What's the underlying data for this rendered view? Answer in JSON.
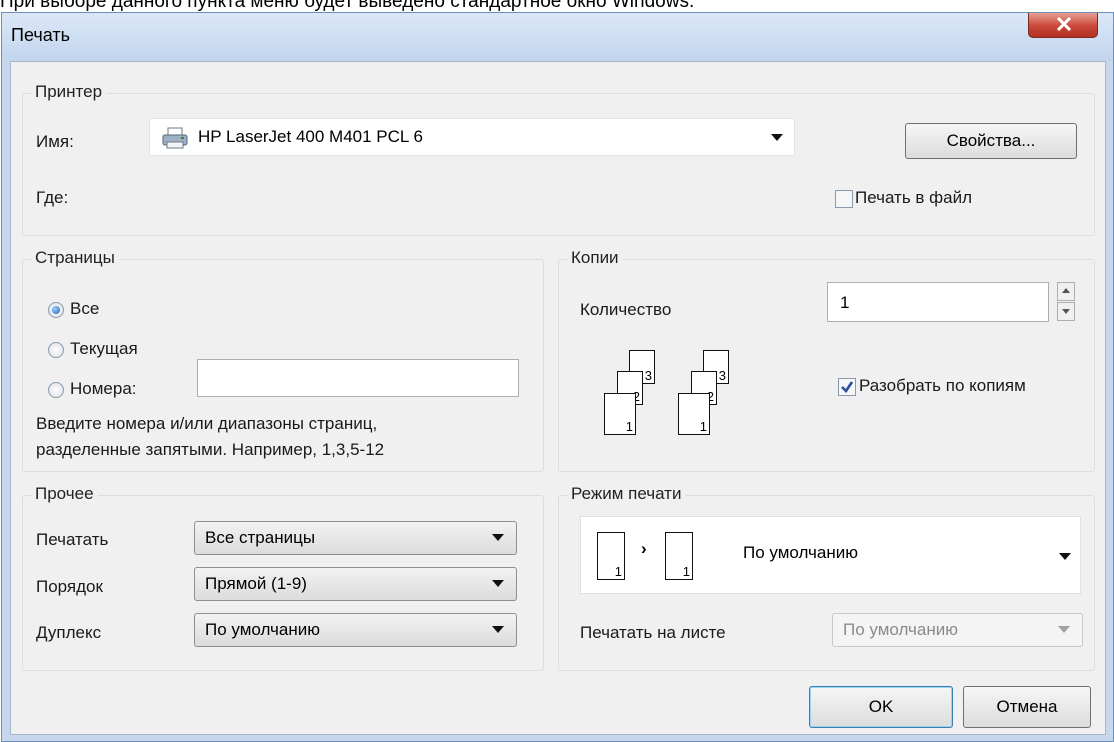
{
  "caption": "При выборе данного пункта меню будет выведено стандартное окно Windows.",
  "window": {
    "title": "Печать"
  },
  "printer": {
    "legend": "Принтер",
    "name_label": "Имя:",
    "name_value": "HP LaserJet 400 M401 PCL 6",
    "where_label": "Где:",
    "properties_button": "Свойства...",
    "print_to_file_label": "Печать в файл",
    "print_to_file_checked": false
  },
  "pages": {
    "legend": "Страницы",
    "all_label": "Все",
    "current_label": "Текущая",
    "numbers_label": "Номера:",
    "numbers_value": "",
    "selected": "all",
    "hint_line1": "Введите номера и/или диапазоны страниц,",
    "hint_line2": "разделенные запятыми. Например, 1,3,5-12"
  },
  "copies": {
    "legend": "Копии",
    "count_label": "Количество",
    "count_value": "1",
    "collate_label": "Разобрать по копиям",
    "collate_checked": true,
    "page_numbers": [
      "1",
      "2",
      "3"
    ]
  },
  "other": {
    "legend": "Прочее",
    "print_label": "Печатать",
    "print_value": "Все страницы",
    "order_label": "Порядок",
    "order_value": "Прямой (1-9)",
    "duplex_label": "Дуплекс",
    "duplex_value": "По умолчанию"
  },
  "mode": {
    "legend": "Режим печати",
    "mode_value": "По умолчанию",
    "mode_page_number": "1",
    "per_sheet_label": "Печатать на листе",
    "per_sheet_value": "По умолчанию"
  },
  "buttons": {
    "ok": "OK",
    "cancel": "Отмена"
  }
}
